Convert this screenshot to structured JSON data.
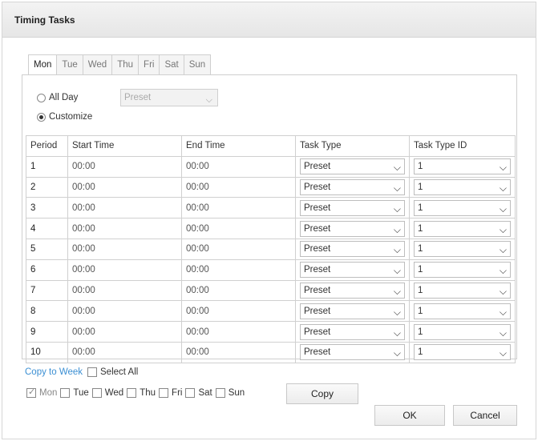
{
  "title": "Timing Tasks",
  "tabs": [
    "Mon",
    "Tue",
    "Wed",
    "Thu",
    "Fri",
    "Sat",
    "Sun"
  ],
  "active_tab": "Mon",
  "mode": {
    "all_day_label": "All Day",
    "customize_label": "Customize",
    "selected": "Customize",
    "all_day_select_value": "Preset"
  },
  "table": {
    "headers": [
      "Period",
      "Start Time",
      "End Time",
      "Task Type",
      "Task Type ID"
    ],
    "rows": [
      {
        "period": "1",
        "start": "00:00",
        "end": "00:00",
        "task_type": "Preset",
        "task_type_id": "1"
      },
      {
        "period": "2",
        "start": "00:00",
        "end": "00:00",
        "task_type": "Preset",
        "task_type_id": "1"
      },
      {
        "period": "3",
        "start": "00:00",
        "end": "00:00",
        "task_type": "Preset",
        "task_type_id": "1"
      },
      {
        "period": "4",
        "start": "00:00",
        "end": "00:00",
        "task_type": "Preset",
        "task_type_id": "1"
      },
      {
        "period": "5",
        "start": "00:00",
        "end": "00:00",
        "task_type": "Preset",
        "task_type_id": "1"
      },
      {
        "period": "6",
        "start": "00:00",
        "end": "00:00",
        "task_type": "Preset",
        "task_type_id": "1"
      },
      {
        "period": "7",
        "start": "00:00",
        "end": "00:00",
        "task_type": "Preset",
        "task_type_id": "1"
      },
      {
        "period": "8",
        "start": "00:00",
        "end": "00:00",
        "task_type": "Preset",
        "task_type_id": "1"
      },
      {
        "period": "9",
        "start": "00:00",
        "end": "00:00",
        "task_type": "Preset",
        "task_type_id": "1"
      },
      {
        "period": "10",
        "start": "00:00",
        "end": "00:00",
        "task_type": "Preset",
        "task_type_id": "1"
      }
    ]
  },
  "copy": {
    "copy_to_week_label": "Copy to Week",
    "select_all_label": "Select All",
    "days": [
      {
        "label": "Mon",
        "checked": true,
        "disabled": true
      },
      {
        "label": "Tue",
        "checked": false
      },
      {
        "label": "Wed",
        "checked": false
      },
      {
        "label": "Thu",
        "checked": false
      },
      {
        "label": "Fri",
        "checked": false
      },
      {
        "label": "Sat",
        "checked": false
      },
      {
        "label": "Sun",
        "checked": false
      }
    ],
    "copy_button": "Copy"
  },
  "footer": {
    "ok": "OK",
    "cancel": "Cancel"
  },
  "colors": {
    "link": "#3b8fd3",
    "titlebar": "#e9e9e9"
  },
  "icons": {
    "dropdown": "chevron-down-icon"
  }
}
